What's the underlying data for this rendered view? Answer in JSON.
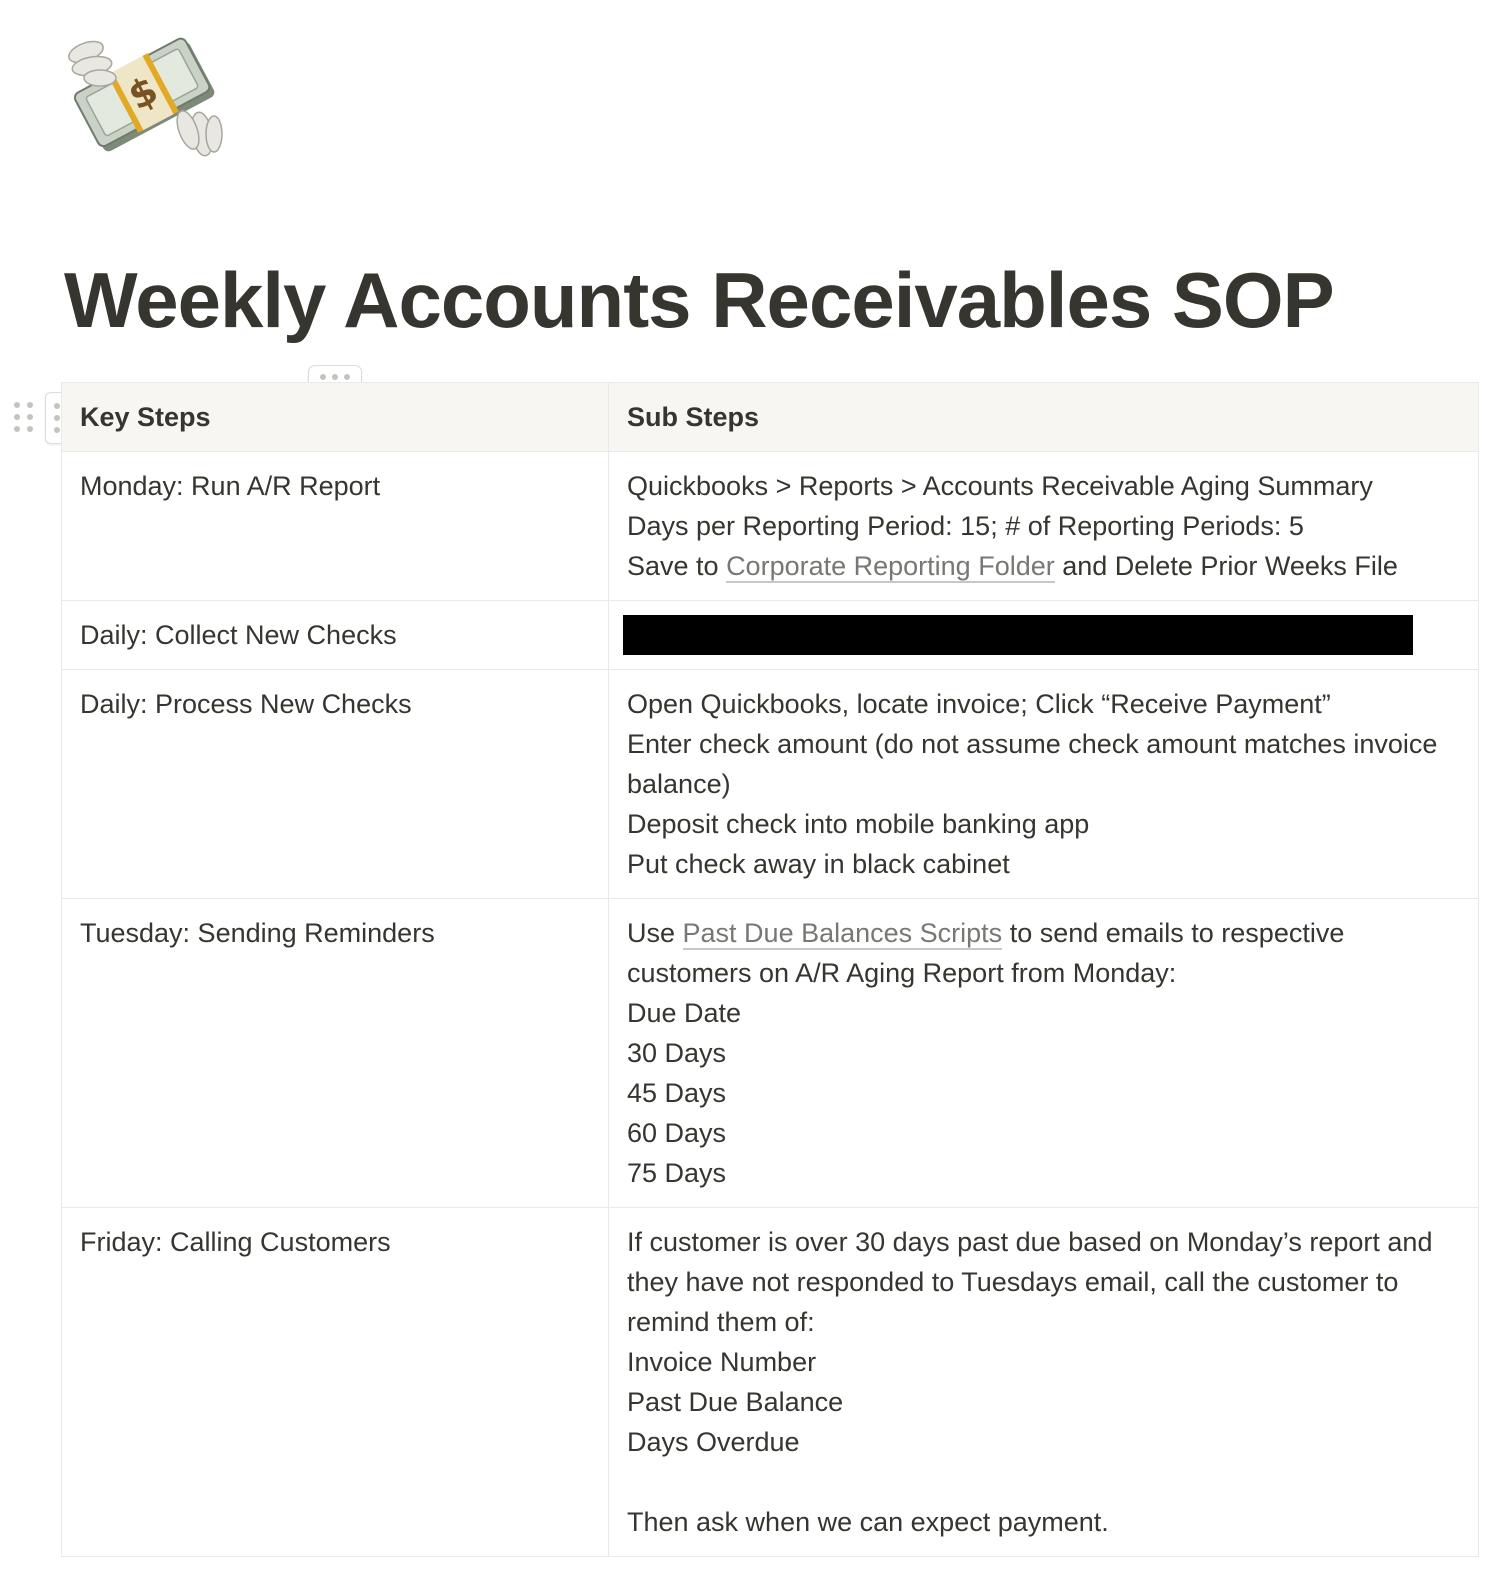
{
  "page": {
    "icon": "money-with-wings-icon",
    "title": "Weekly Accounts Receivables SOP"
  },
  "table": {
    "headers": [
      "Key Steps",
      "Sub Steps"
    ],
    "rows": [
      {
        "key": "Monday: Run A/R Report",
        "sub": [
          {
            "text": "Quickbooks > Reports > Accounts Receivable Aging Summary"
          },
          {
            "text": "Days per Reporting Period: 15; # of Reporting Periods: 5"
          },
          {
            "before": "Save to ",
            "link": "Corporate Reporting Folder",
            "after": " and Delete Prior Weeks File"
          }
        ]
      },
      {
        "key": "Daily: Collect New Checks",
        "sub": [],
        "redacted": true
      },
      {
        "key": "Daily: Process New Checks",
        "sub": [
          {
            "text": "Open Quickbooks, locate invoice; Click “Receive Payment”"
          },
          {
            "text": "Enter check amount (do not assume check amount matches invoice balance)"
          },
          {
            "text": "Deposit check into mobile banking app"
          },
          {
            "text": "Put check away in black cabinet"
          }
        ]
      },
      {
        "key": "Tuesday: Sending Reminders",
        "sub": [
          {
            "before": "Use ",
            "link": "Past Due Balances Scripts",
            "after": " to send emails to respective customers on A/R Aging Report from Monday:"
          },
          {
            "text": "Due Date"
          },
          {
            "text": "30 Days"
          },
          {
            "text": "45 Days"
          },
          {
            "text": "60 Days"
          },
          {
            "text": "75 Days"
          }
        ]
      },
      {
        "key": "Friday: Calling Customers",
        "sub": [
          {
            "text": "If customer is over 30 days past due based on Monday’s report and they have not responded to Tuesdays email, call the customer to remind them of:"
          },
          {
            "text": "Invoice Number"
          },
          {
            "text": "Past Due Balance"
          },
          {
            "text": "Days Overdue"
          },
          {
            "text": ""
          },
          {
            "text": "Then ask when we can expect payment."
          }
        ]
      }
    ]
  }
}
